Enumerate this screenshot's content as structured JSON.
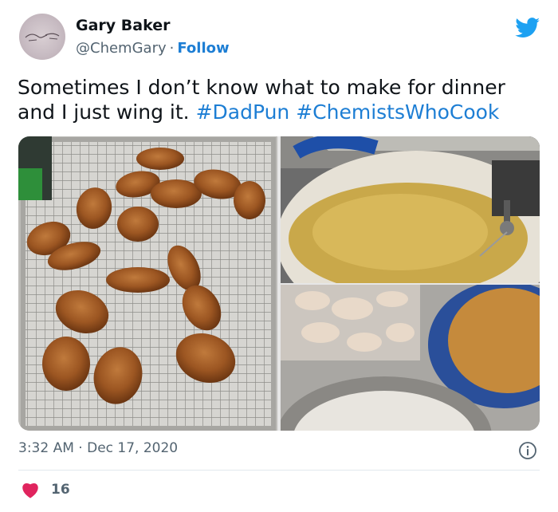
{
  "user": {
    "name": "Gary Baker",
    "handle": "@ChemGary",
    "separator": "·",
    "follow_label": "Follow"
  },
  "tweet": {
    "text_plain": "Sometimes I don’t know what to make for dinner and I just wing it. ",
    "hashtags": [
      "#DadPun",
      "#ChemistsWhoCook"
    ]
  },
  "meta": {
    "time": "3:32 AM",
    "separator": "·",
    "date": "Dec 17, 2020"
  },
  "engagement": {
    "likes": "16"
  },
  "icons": {
    "logo": "twitter-bird-icon",
    "info": "info-icon",
    "like": "heart-icon"
  },
  "colors": {
    "link": "#1d7ed4",
    "twitter_blue": "#1da1f2",
    "heart": "#e0245e",
    "secondary_text": "#536471"
  },
  "media": {
    "photos": [
      "fried chicken wings on cooling rack",
      "pot of hot frying oil with thermometer",
      "raw wings and bowl of flour beside pot of oil"
    ]
  }
}
